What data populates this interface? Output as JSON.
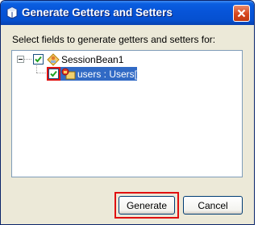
{
  "window": {
    "title": "Generate Getters and Setters"
  },
  "prompt": "Select fields to generate getters and setters for:",
  "tree": {
    "root": {
      "label": "SessionBean1",
      "checked": true,
      "expanded": true
    },
    "children": [
      {
        "label": "users : Users[]",
        "checked": true,
        "selected": true
      }
    ]
  },
  "buttons": {
    "generate": "Generate",
    "cancel": "Cancel"
  },
  "colors": {
    "titlebar": "#0754d8",
    "selection": "#316ac5",
    "highlight": "#e01010",
    "dialog_bg": "#ece9d8"
  },
  "icons": [
    "app-icon",
    "close-icon",
    "expander-minus-icon",
    "check-icon",
    "session-bean-icon",
    "field-icon"
  ]
}
